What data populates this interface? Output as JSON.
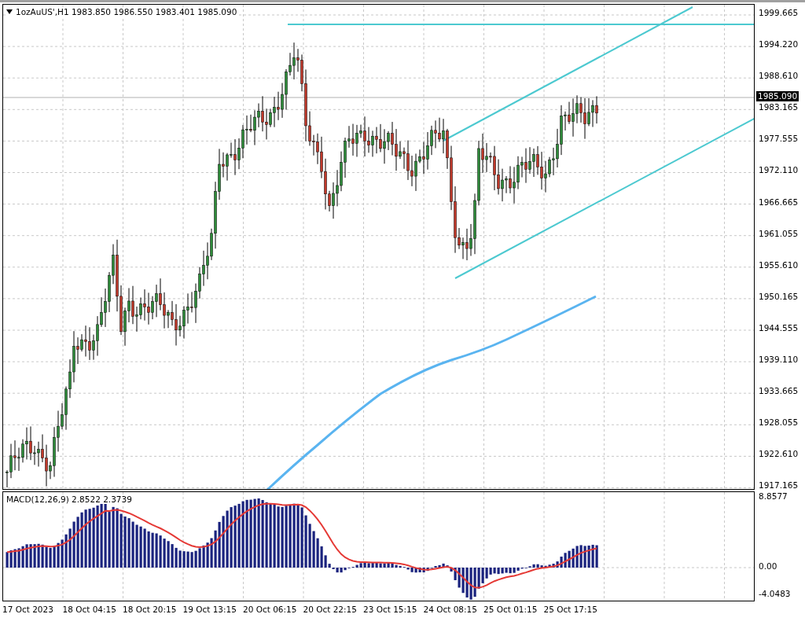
{
  "symbol_bar": {
    "text": "1ozAuUS',H1 1983.850 1986.550 1983.401 1985.090"
  },
  "price_axis": {
    "ticks": [
      "1999.665",
      "1994.220",
      "1988.610",
      "1983.165",
      "1977.555",
      "1972.110",
      "1966.665",
      "1961.055",
      "1955.610",
      "1950.165",
      "1944.555",
      "1939.110",
      "1933.665",
      "1928.055",
      "1922.610",
      "1917.165"
    ],
    "current_price": "1985.090"
  },
  "macd": {
    "label": "MACD(12,26,9) 2.8522 2.3739",
    "ticks": [
      "8.8577",
      "0.00",
      "-4.0483"
    ]
  },
  "time_axis": {
    "labels": [
      "17 Oct 2023",
      "18 Oct 04:15",
      "18 Oct 20:15",
      "19 Oct 13:15",
      "20 Oct 06:15",
      "20 Oct 22:15",
      "23 Oct 15:15",
      "24 Oct 08:15",
      "25 Oct 01:15",
      "25 Oct 17:15"
    ]
  }
}
